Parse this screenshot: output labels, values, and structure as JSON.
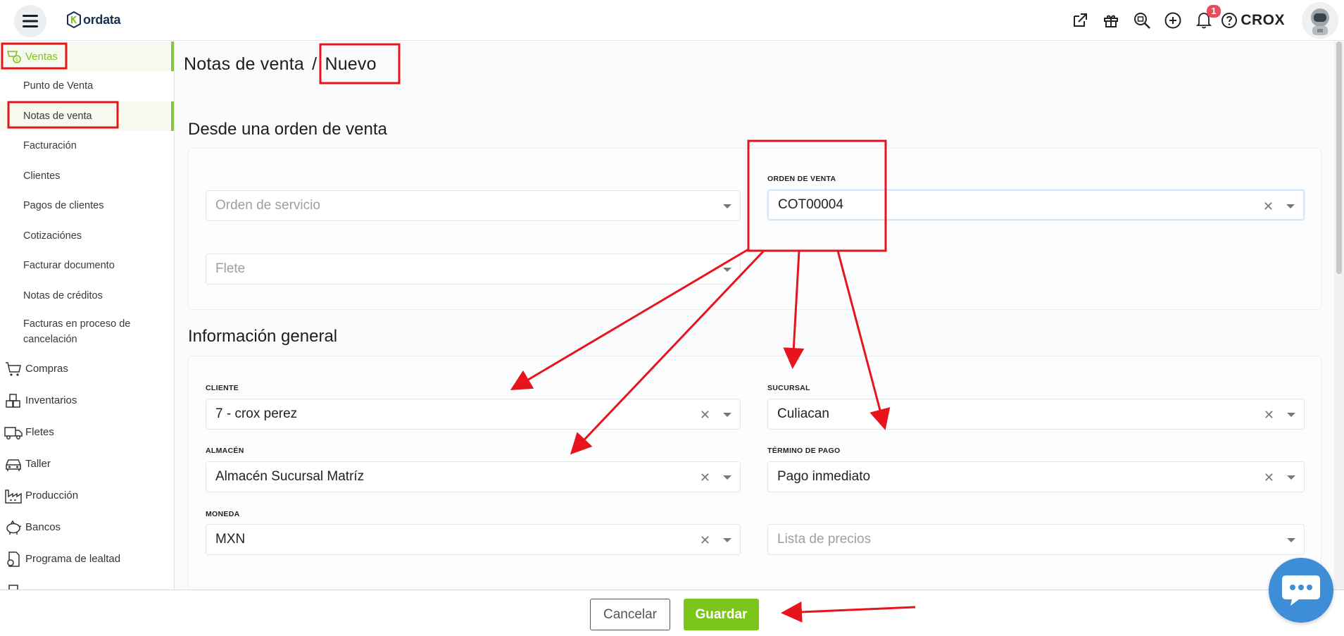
{
  "app": {
    "logo_text": "ordata",
    "user_name": "CROX",
    "notification_count": "1"
  },
  "topbar_icons": [
    "external-link-icon",
    "gift-icon",
    "search-zoom-icon",
    "add-circle-icon",
    "bell-icon",
    "help-icon"
  ],
  "sidebar": {
    "active_section": "Ventas",
    "sub_items": [
      "Punto de Venta",
      "Notas de venta",
      "Facturación",
      "Clientes",
      "Pagos de clientes",
      "Cotizaciónes",
      "Facturar documento",
      "Notas de créditos",
      "Facturas en proceso de cancelación"
    ],
    "active_sub_item": "Notas de venta",
    "main_items": [
      "Compras",
      "Inventarios",
      "Fletes",
      "Taller",
      "Producción",
      "Bancos",
      "Programa de lealtad"
    ]
  },
  "breadcrumb": {
    "parent": "Notas de venta",
    "separator": "/",
    "current": "Nuevo"
  },
  "section_from_order": {
    "title": "Desde una orden de venta",
    "orden_servicio_placeholder": "Orden de servicio",
    "flete_placeholder": "Flete",
    "orden_venta_label": "ORDEN DE VENTA",
    "orden_venta_value": "COT00004"
  },
  "section_general": {
    "title": "Información general",
    "cliente_label": "CLIENTE",
    "cliente_value": "7 - crox perez",
    "sucursal_label": "SUCURSAL",
    "sucursal_value": "Culiacan",
    "almacen_label": "ALMACÉN",
    "almacen_value": "Almacén Sucursal Matríz",
    "termino_label": "TÉRMINO DE PAGO",
    "termino_value": "Pago inmediato",
    "moneda_label": "MONEDA",
    "moneda_value": "MXN",
    "lista_precios_placeholder": "Lista de precios"
  },
  "footer": {
    "cancel_label": "Cancelar",
    "save_label": "Guardar"
  },
  "colors": {
    "accent": "#7cc51a",
    "annotation": "#e8141c",
    "chat": "#3d8ed6"
  }
}
